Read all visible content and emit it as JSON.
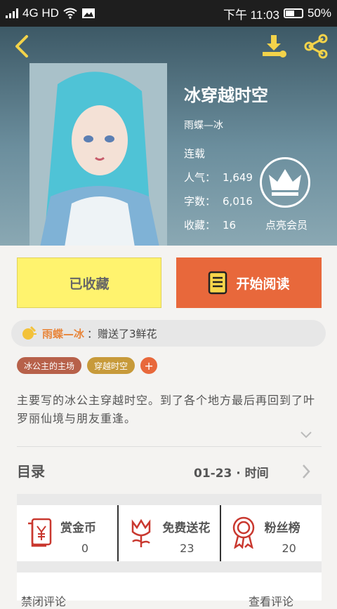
{
  "status_bar": {
    "network": "4G HD",
    "time": "下午 11:03",
    "battery": "50%"
  },
  "book": {
    "title": "冰穿越时空",
    "author": "雨蝶—冰",
    "status": "连载",
    "popularity_label": "人气：",
    "popularity": "1,649",
    "words_label": "字数：",
    "words": "6,016",
    "favorites_label": "收藏：",
    "favorites": "16",
    "vip_label": "点亮会员"
  },
  "actions": {
    "collected_label": "已收藏",
    "read_label": "开始阅读"
  },
  "gift": {
    "user": "雨蝶—冰",
    "text": "：赠送了3鲜花"
  },
  "tags": [
    {
      "label": "冰公主的主场",
      "color": "#b7614a"
    },
    {
      "label": "穿越时空",
      "color": "#c79a3a"
    }
  ],
  "tag_add": "+",
  "description": "主要写的冰公主穿越时空。到了各个地方最后再回到了叶罗丽仙境与朋友重逢。",
  "toc": {
    "label": "目录",
    "info": "01-23 · 时间"
  },
  "rewards": [
    {
      "icon": "red-envelope-icon",
      "label": "赏金币",
      "value": "0"
    },
    {
      "icon": "flower-icon",
      "label": "免费送花",
      "value": "23"
    },
    {
      "icon": "medal-icon",
      "label": "粉丝榜",
      "value": "20"
    }
  ],
  "next_section": {
    "left": "禁闭评论",
    "right": "查看评论"
  },
  "colors": {
    "accent_orange": "#e8683b",
    "collected_yellow": "#fff36e",
    "icon_red": "#c9382f"
  }
}
